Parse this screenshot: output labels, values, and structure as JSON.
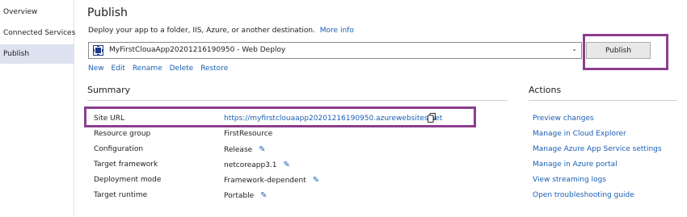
{
  "sidebar": {
    "items": [
      {
        "label": "Overview"
      },
      {
        "label": "Connected Services"
      },
      {
        "label": "Publish"
      }
    ]
  },
  "header": {
    "title": "Publish",
    "description": "Deploy your app to a folder, IIS, Azure, or another destination.",
    "more_info": "More info"
  },
  "profile": {
    "selected": "MyFirstClouaApp20201216190950 - Web Deploy"
  },
  "toolbar": {
    "publish_label": "Publish",
    "new": "New",
    "edit": "Edit",
    "rename": "Rename",
    "delete": "Delete",
    "restore": "Restore"
  },
  "summary": {
    "heading": "Summary",
    "rows": [
      {
        "label": "Site URL",
        "value": "https://myfirstclouaapp20201216190950.azurewebsites.net"
      },
      {
        "label": "Resource group",
        "value": "FirstResource"
      },
      {
        "label": "Configuration",
        "value": "Release"
      },
      {
        "label": "Target framework",
        "value": "netcoreapp3.1"
      },
      {
        "label": "Deployment mode",
        "value": "Framework-dependent"
      },
      {
        "label": "Target runtime",
        "value": "Portable"
      }
    ]
  },
  "actions": {
    "heading": "Actions",
    "items": [
      {
        "label": "Preview changes"
      },
      {
        "label": "Manage in Cloud Explorer"
      },
      {
        "label": "Manage Azure App Service settings"
      },
      {
        "label": "Manage in Azure portal"
      },
      {
        "label": "View streaming logs"
      },
      {
        "label": "Open troubleshooting guide"
      }
    ]
  },
  "colors": {
    "highlight_border": "#8b3f8e",
    "link": "#1a5fb4",
    "sidebar_selected": "#dde1f0"
  },
  "icons": {
    "profile": "web-deploy-icon",
    "copy": "copy-icon",
    "edit": "pencil-icon",
    "dropdown": "chevron-down-icon"
  }
}
